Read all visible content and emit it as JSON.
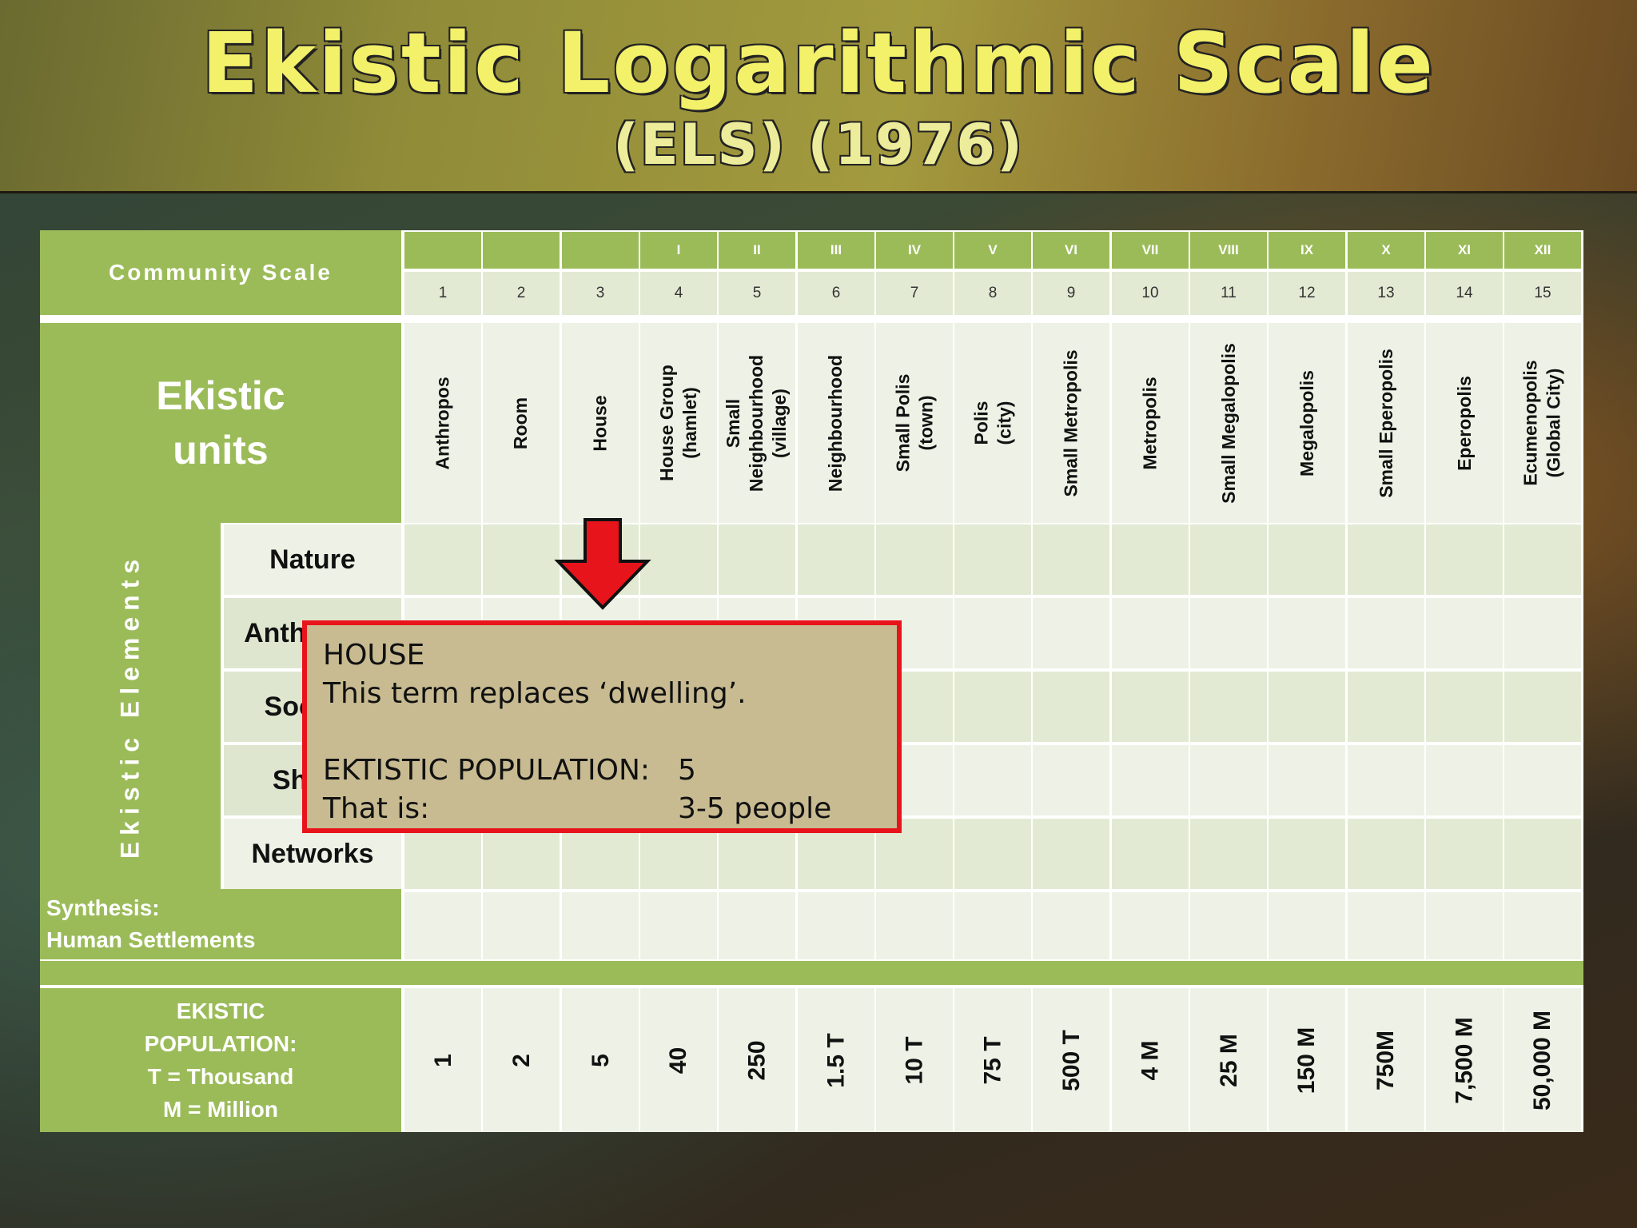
{
  "title": "Ekistic Logarithmic Scale",
  "subtitle": "(ELS) (1976)",
  "community_scale_label": "Community Scale",
  "ekistic_units_label": "Ekistic\nunits",
  "ekistic_elements_label": "Ekistic Elements",
  "roman_numerals": [
    "",
    "",
    "",
    "I",
    "II",
    "III",
    "IV",
    "V",
    "VI",
    "VII",
    "VIII",
    "IX",
    "X",
    "XI",
    "XII"
  ],
  "scale_numbers": [
    "1",
    "2",
    "3",
    "4",
    "5",
    "6",
    "7",
    "8",
    "9",
    "10",
    "11",
    "12",
    "13",
    "14",
    "15"
  ],
  "units": [
    "Anthropos",
    "Room",
    "House",
    "House Group\n(hamlet)",
    "Small\nNeighbourhood\n(village)",
    "Neighbourhood",
    "Small Polis\n(town)",
    "Polis\n(city)",
    "Small Metropolis",
    "Metropolis",
    "Small Megalopolis",
    "Megalopolis",
    "Small Eperopolis",
    "Eperopolis",
    "Ecumenopolis\n(Global City)"
  ],
  "elements": [
    "Nature",
    "Anthropos",
    "Society",
    "Shells",
    "Networks"
  ],
  "synthesis_label": "Synthesis:\nHuman Settlements",
  "population_label": [
    "EKISTIC",
    "POPULATION:",
    "T = Thousand",
    "M = Million"
  ],
  "populations": [
    "1",
    "2",
    "5",
    "40",
    "250",
    "1.5 T",
    "10 T",
    "75 T",
    "500 T",
    "4 M",
    "25 M",
    "150 M",
    "750M",
    "7,500 M",
    "50,000 M"
  ],
  "popup": {
    "heading": "HOUSE",
    "description": "This term replaces ‘dwelling’.",
    "population_label": "EKTISTIC POPULATION:",
    "population_value": "5",
    "that_is_label": "That is:",
    "that_is_value": "3-5 people"
  },
  "colors": {
    "table_green": "#9bbb59",
    "popup_border": "#e8141c",
    "popup_fill": "#c8bb91",
    "arrow": "#e8141c",
    "title_text": "#f3f06a"
  }
}
